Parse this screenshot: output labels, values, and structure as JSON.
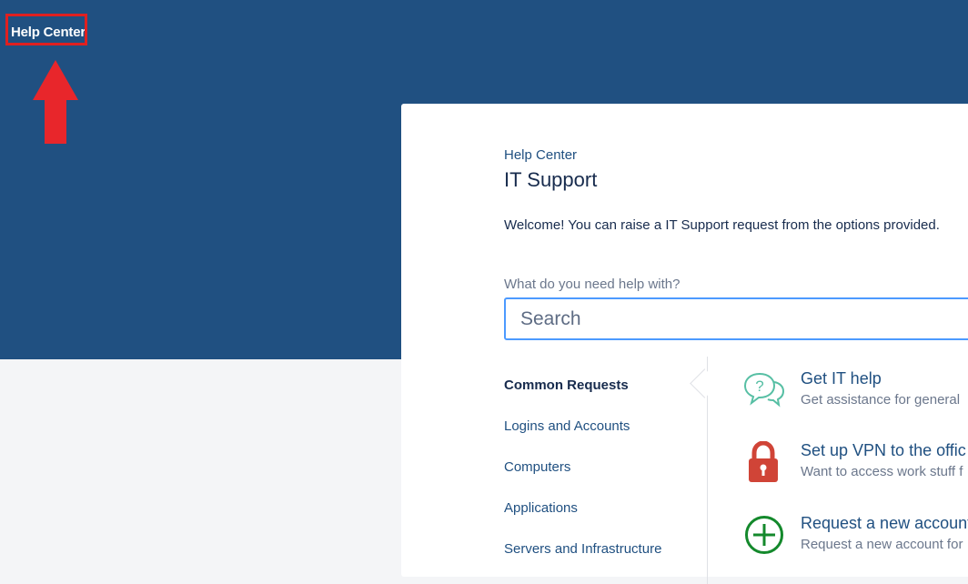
{
  "header": {
    "help_center_link": "Help Center"
  },
  "portal": {
    "breadcrumb": "Help Center",
    "title": "IT Support",
    "welcome": "Welcome! You can raise a IT Support request from the options provided.",
    "search_label": "What do you need help with?",
    "search_placeholder": "Search"
  },
  "categories": [
    {
      "label": "Common Requests",
      "active": true
    },
    {
      "label": "Logins and Accounts"
    },
    {
      "label": "Computers"
    },
    {
      "label": "Applications"
    },
    {
      "label": "Servers and Infrastructure"
    }
  ],
  "requests": [
    {
      "title": "Get IT help",
      "desc": "Get assistance for general",
      "icon": "question-chat-icon"
    },
    {
      "title": "Set up VPN to the offic",
      "desc": "Want to access work stuff f",
      "icon": "lock-icon"
    },
    {
      "title": "Request a new account",
      "desc": "Request a new account for",
      "icon": "plus-circle-icon"
    }
  ],
  "colors": {
    "banner": "#205081",
    "link": "#205081",
    "highlight": "#e02020",
    "arrow": "#e8262b",
    "lock": "#d04437",
    "plus": "#14892c",
    "chat": "#57bfa4"
  }
}
